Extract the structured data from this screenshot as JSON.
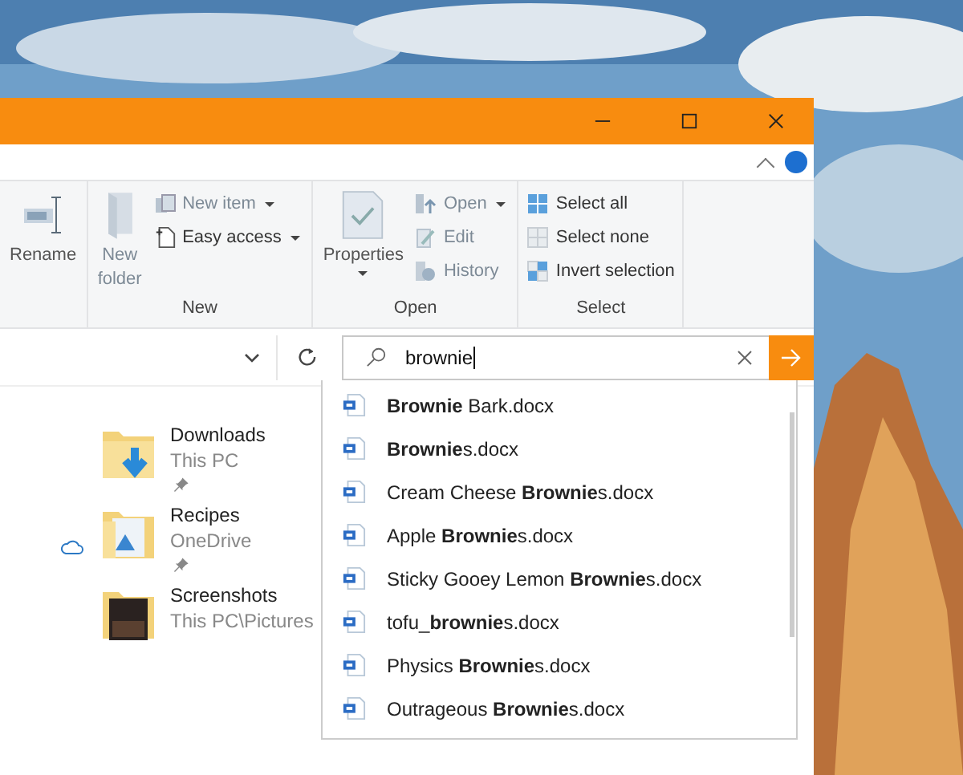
{
  "ribbon": {
    "groups": [
      {
        "items": [
          {
            "kind": "large",
            "label": "Rename"
          }
        ]
      },
      {
        "label": "New",
        "items": [
          {
            "kind": "large",
            "label": "New\nfolder",
            "disabled": true
          },
          {
            "kind": "small",
            "label": "New item",
            "dropdown": true,
            "disabled": true
          },
          {
            "kind": "small",
            "label": "Easy access",
            "dropdown": true,
            "disabled": false
          }
        ]
      },
      {
        "label": "Open",
        "items": [
          {
            "kind": "large",
            "label": "Properties",
            "dropdown": true,
            "disabled": false
          },
          {
            "kind": "small",
            "label": "Open",
            "dropdown": true,
            "disabled": true
          },
          {
            "kind": "small",
            "label": "Edit",
            "disabled": true
          },
          {
            "kind": "small",
            "label": "History",
            "disabled": true
          }
        ]
      },
      {
        "label": "Select",
        "items": [
          {
            "kind": "small",
            "label": "Select all",
            "disabled": false
          },
          {
            "kind": "small",
            "label": "Select none",
            "disabled": false
          },
          {
            "kind": "small",
            "label": "Invert selection",
            "disabled": false
          }
        ]
      }
    ]
  },
  "search": {
    "value": "brownie",
    "results": [
      {
        "name": "**Brownie** Bark.docx"
      },
      {
        "name": "**Brownie**s.docx"
      },
      {
        "name": "Cream Cheese **Brownie**s.docx"
      },
      {
        "name": "Apple **Brownie**s.docx"
      },
      {
        "name": "Sticky Gooey Lemon **Brownie**s.docx"
      },
      {
        "name": "tofu_**brownie**s.docx"
      },
      {
        "name": "Physics **Brownie**s.docx"
      },
      {
        "name": "Outrageous **Brownie**s.docx"
      }
    ]
  },
  "quick_access": [
    {
      "name": "Downloads",
      "location": "This PC",
      "pinned": true,
      "cloud": false
    },
    {
      "name": "Recipes",
      "location": "OneDrive",
      "pinned": true,
      "cloud": true
    },
    {
      "name": "Screenshots",
      "location": "This PC\\Pictures",
      "pinned": false,
      "cloud": false
    }
  ]
}
